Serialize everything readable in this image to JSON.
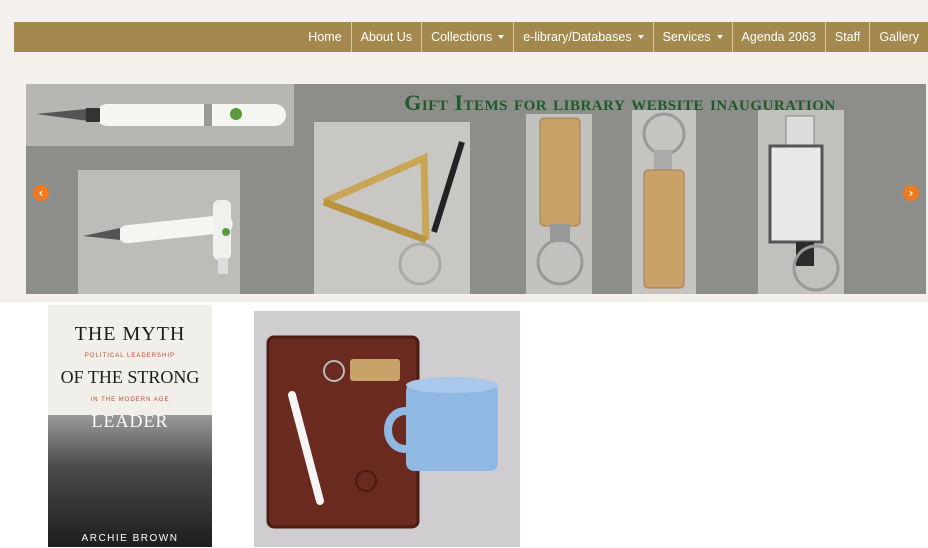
{
  "nav": {
    "items": [
      {
        "label": "Home",
        "dropdown": false
      },
      {
        "label": "About Us",
        "dropdown": false
      },
      {
        "label": "Collections",
        "dropdown": true
      },
      {
        "label": "e-library/Databases",
        "dropdown": true
      },
      {
        "label": "Services",
        "dropdown": true
      },
      {
        "label": "Agenda 2063",
        "dropdown": false
      },
      {
        "label": "Staff",
        "dropdown": false
      },
      {
        "label": "Gallery",
        "dropdown": false
      }
    ]
  },
  "slider": {
    "title": "Gift Items for library website inauguration",
    "prev_icon": "chevron-left-icon",
    "next_icon": "chevron-right-icon",
    "arrow_color": "#f07a1e"
  },
  "book": {
    "title_line1": "THE MYTH",
    "subtitle_line1": "POLITICAL LEADERSHIP",
    "title_line2": "OF THE STRONG",
    "subtitle_line2": "IN THE MODERN AGE",
    "title_line3": "LEADER",
    "author": "ARCHIE BROWN"
  },
  "colors": {
    "nav_bg": "#a3894e",
    "title_green": "#1f5a2a"
  }
}
